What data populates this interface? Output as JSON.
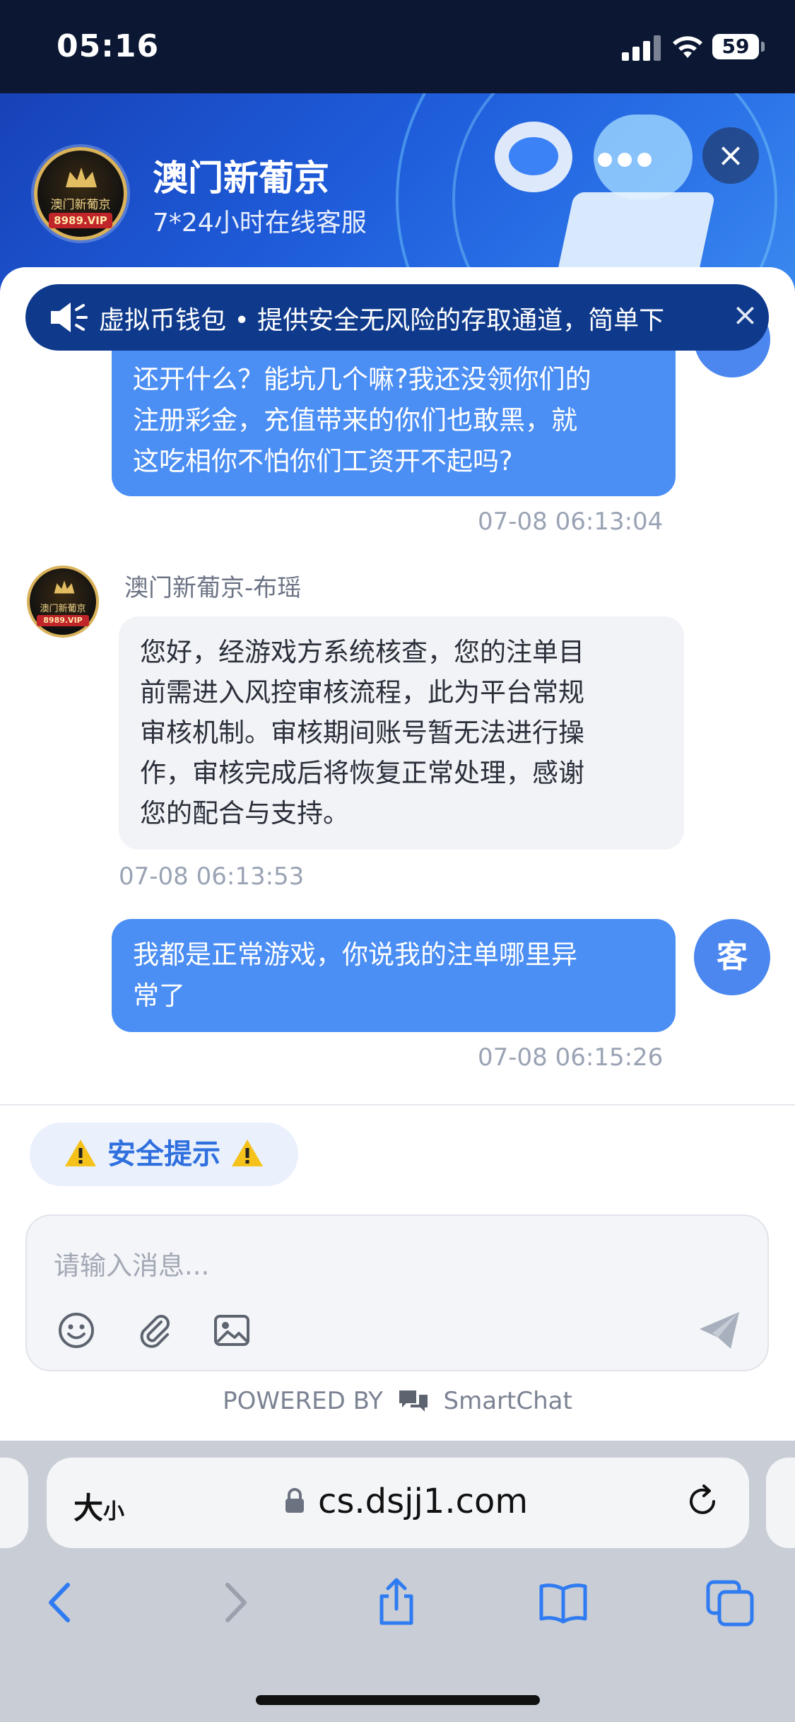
{
  "status_bar": {
    "time": "05:16",
    "battery": "59"
  },
  "header": {
    "logo_text": "澳门新葡京",
    "logo_sub": "8989.VIP",
    "brand_name": "澳门新葡京",
    "subtitle": "7*24小时在线客服"
  },
  "notice": {
    "text": "虚拟币钱包 • 提供安全无风险的存取通道，简单下"
  },
  "messages": [
    {
      "type": "outgoing",
      "text": "还开什么？能坑几个嘛?我还没领你们的注册彩金，充值带来的你们也敢黑，就这吃相你不怕你们工资开不起吗?",
      "lines": [
        "还开什么？能坑几个嘛?我还没领你们的",
        "注册彩金，充值带来的你们也敢黑，就",
        "这吃相你不怕你们工资开不起吗?"
      ],
      "time": "07-08 06:13:04"
    },
    {
      "type": "incoming",
      "sender": "澳门新葡京-布瑶",
      "lines": [
        "您好，经游戏方系统核查，您的注单目",
        "前需进入风控审核流程，此为平台常规",
        "审核机制。审核期间账号暂无法进行操",
        "作，审核完成后将恢复正常处理，感谢",
        "您的配合与支持。"
      ],
      "time": "07-08 06:13:53"
    },
    {
      "type": "outgoing",
      "lines": [
        "我都是正常游戏，你说我的注单哪里异",
        "常了"
      ],
      "time": "07-08 06:15:26",
      "avatar": "客"
    }
  ],
  "safety_tip": "安全提示",
  "input": {
    "placeholder": "请输入消息..."
  },
  "powered": {
    "prefix": "POWERED BY",
    "brand": "SmartChat"
  },
  "browser": {
    "size_label": "大",
    "size_small": "小",
    "url": "cs.dsjj1.com"
  },
  "colors": {
    "accent": "#4b8ef4",
    "banner": "#1f5ddb",
    "notice": "#0f3a8c"
  }
}
